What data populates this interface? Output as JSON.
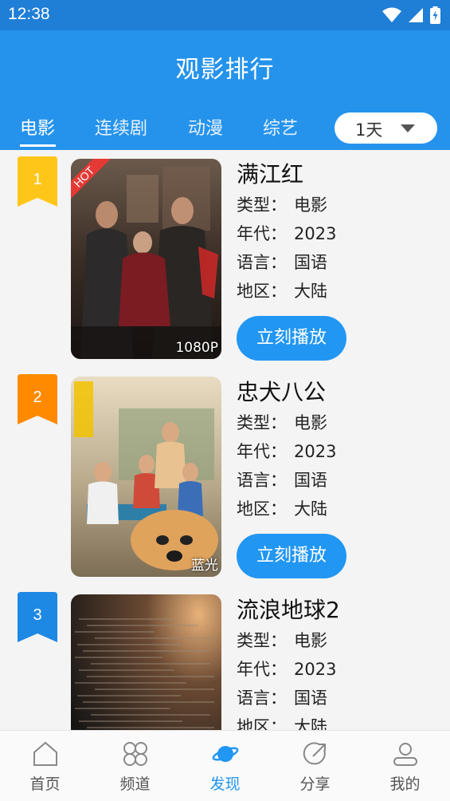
{
  "status_bar": {
    "time": "12:38"
  },
  "header": {
    "title": "观影排行"
  },
  "tabs": [
    {
      "label": "电影",
      "active": true
    },
    {
      "label": "连续剧",
      "active": false
    },
    {
      "label": "动漫",
      "active": false
    },
    {
      "label": "综艺",
      "active": false
    }
  ],
  "period_select": {
    "value": "1天"
  },
  "labels": {
    "type": "类型：",
    "year": "年代：",
    "language": "语言：",
    "region": "地区：",
    "play_button": "立刻播放"
  },
  "movies": [
    {
      "rank": "1",
      "title": "满江红",
      "type": "电影",
      "year": "2023",
      "language": "国语",
      "region": "大陆",
      "quality": "1080P",
      "hot_badge": "HOT",
      "rank_color": "#ffc61a"
    },
    {
      "rank": "2",
      "title": "忠犬八公",
      "type": "电影",
      "year": "2023",
      "language": "国语",
      "region": "大陆",
      "quality": "蓝光",
      "rank_color": "#ff8a00"
    },
    {
      "rank": "3",
      "title": "流浪地球2",
      "type": "电影",
      "year": "2023",
      "language": "国语",
      "region": "大陆",
      "quality": "",
      "rank_color": "#1e88e5"
    }
  ],
  "bottom_nav": [
    {
      "label": "首页",
      "icon": "home-icon"
    },
    {
      "label": "频道",
      "icon": "channels-icon"
    },
    {
      "label": "发现",
      "icon": "discover-planet-icon",
      "active": true
    },
    {
      "label": "分享",
      "icon": "share-icon"
    },
    {
      "label": "我的",
      "icon": "user-icon"
    }
  ],
  "colors": {
    "primary": "#2593ec",
    "accent": "#2196f3",
    "status_bar": "#1f7fd6"
  }
}
